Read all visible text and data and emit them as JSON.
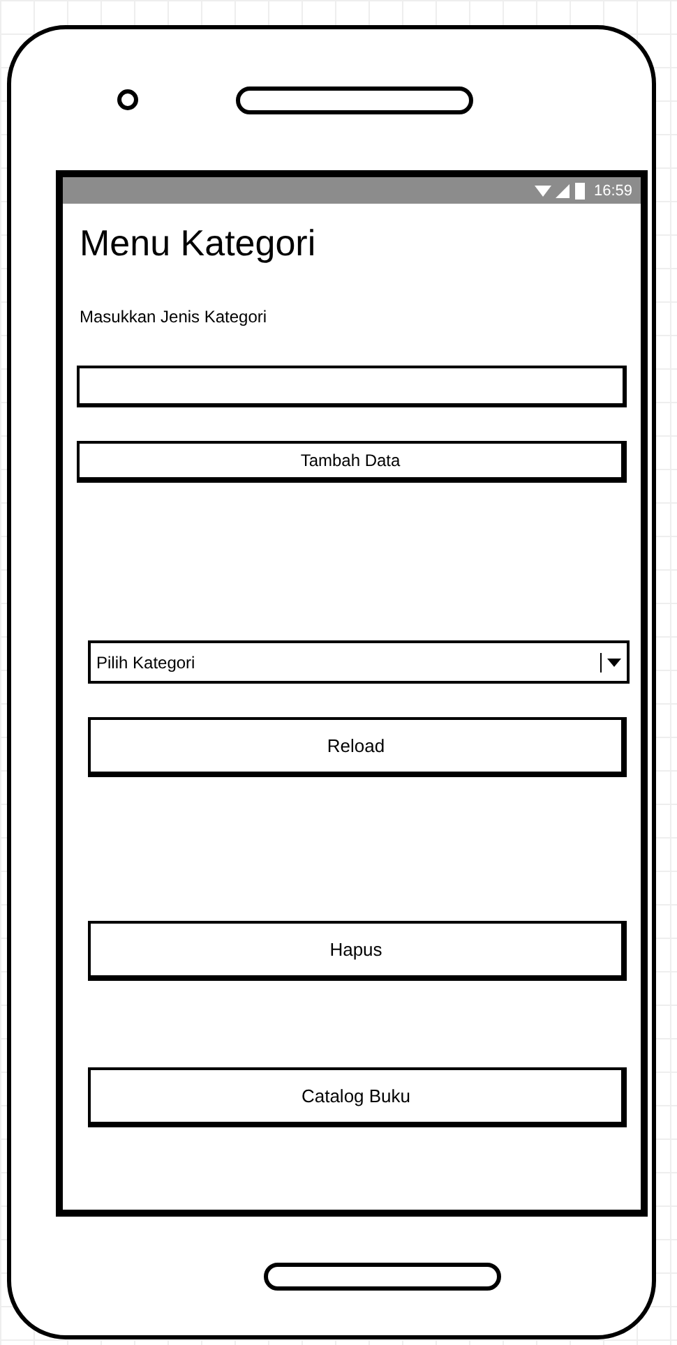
{
  "status_bar": {
    "time": "16:59"
  },
  "title": "Menu Kategori",
  "form": {
    "label": "Masukkan Jenis Kategori",
    "add_button": "Tambah Data"
  },
  "dropdown": {
    "placeholder": "Pilih Kategori"
  },
  "buttons": [
    {
      "label": "Reload"
    },
    {
      "label": "Hapus"
    },
    {
      "label": "Catalog Buku"
    }
  ]
}
